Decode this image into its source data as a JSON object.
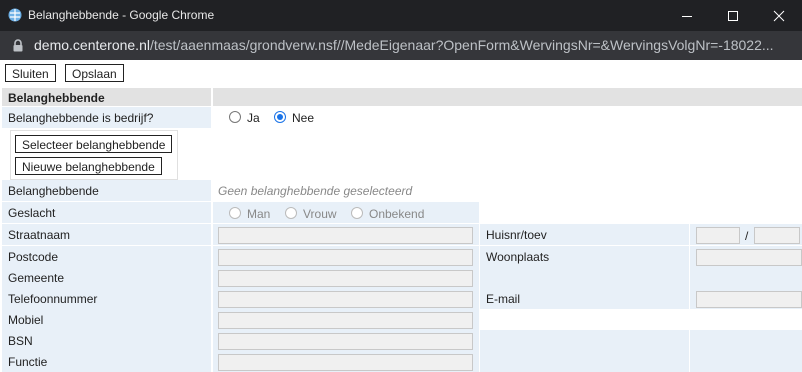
{
  "window": {
    "title": "Belanghebbende - Google Chrome",
    "url_host": "demo.centerone.nl",
    "url_path": "/test/aaenmaas/grondverw.nsf//MedeEigenaar?OpenForm&WervingsNr=&WervingsVolgNr=-18022..."
  },
  "toolbar": {
    "close_label": "Sluiten",
    "save_label": "Opslaan"
  },
  "section": {
    "title": "Belanghebbende"
  },
  "bedrijf": {
    "label": "Belanghebbende is bedrijf?",
    "yes": "Ja",
    "no": "Nee",
    "selected": "Nee"
  },
  "actions": {
    "select_label": "Selecteer belanghebbende",
    "new_label": "Nieuwe belanghebbende"
  },
  "belanghebbende": {
    "label": "Belanghebbende",
    "value": "Geen belanghebbende geselecteerd"
  },
  "geslacht": {
    "label": "Geslacht",
    "options": [
      "Man",
      "Vrouw",
      "Onbekend"
    ]
  },
  "fields": {
    "straatnaam": "Straatnaam",
    "huisnr": "Huisnr/toev",
    "huisnr_sep": "/",
    "postcode": "Postcode",
    "woonplaats": "Woonplaats",
    "gemeente": "Gemeente",
    "telefoon": "Telefoonnummer",
    "email": "E-mail",
    "mobiel": "Mobiel",
    "bsn": "BSN",
    "functie": "Functie"
  }
}
